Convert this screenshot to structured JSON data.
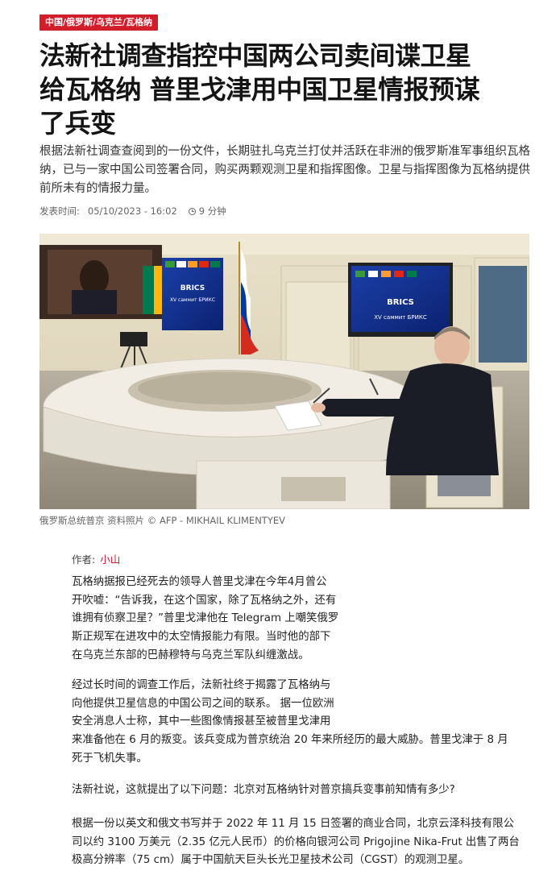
{
  "category_tag": "中国/俄罗斯/乌克兰/瓦格纳",
  "headline_lines": [
    "法新社调查指控中国两公司卖间谍卫星",
    "给瓦格纳 普里戈津用中国卫星情报预谋",
    "了兵变"
  ],
  "lede": "根据法新社调查查阅到的一份文件，长期驻扎乌克兰打仗并活跃在非洲的俄罗斯准军事组织瓦格纳，已与一家中国公司签署合同，购买两颗观测卫星和指挥图像。卫星与指挥图像为瓦格纳提供前所未有的情报力量。",
  "meta": {
    "published_label": "发表时间:",
    "published_date": "05/10/2023 - 16:02",
    "read_time": "9 分钟"
  },
  "photo": {
    "screen_text_left": "BRICS",
    "screen_text_left_sub": "XV саммит БРИКС",
    "screen_text_right": "BRICS",
    "screen_text_right_sub": "XV саммит БРИКС",
    "caption": "俄罗斯总统普京 资料照片 © AFP - MIKHAIL KLIMENTYEV"
  },
  "author": {
    "label": "作者:",
    "name": "小山"
  },
  "paragraphs": {
    "p1": [
      "瓦格纳据报已经死去的领导人普里戈津在今年4月曾公",
      "开吹嘘：“告诉我，在这个国家，除了瓦格纳之外，还有",
      "谁拥有侦察卫星？”普里戈津他在 Telegram 上嘲笑俄罗",
      "斯正规军在进攻中的太空情报能力有限。当时他的部下",
      "在乌克兰东部的巴赫穆特与乌克兰军队纠缠激战。"
    ],
    "p2": [
      "经过长时间的调查工作后，法新社终于揭露了瓦格纳与",
      "向他提供卫星信息的中国公司之间的联系。 据一位欧洲",
      "安全消息人士称，其中一些图像情报甚至被普里戈津用",
      "来准备他在 6 月的叛变。该兵变成为普京统治 20 年来所经历的最大威胁。普里戈津于 8 月",
      "死于飞机失事。"
    ],
    "p3": [
      "法新社说，这就提出了以下问题：北京对瓦格纳针对普京搞兵变事前知情有多少?"
    ],
    "p4": [
      "根据一份以英文和俄文书写并于 2022 年 11 月 15 日签署的商业合同，北京云泽科技有限公",
      "司以约 3100 万美元（2.35 亿元人民币）的价格向银河公司 Prigojine Nika-Frut 出售了两台",
      "极高分辨率（75 cm）属于中国航天巨头长光卫星技术公司（CGST）的观测卫星。"
    ]
  }
}
